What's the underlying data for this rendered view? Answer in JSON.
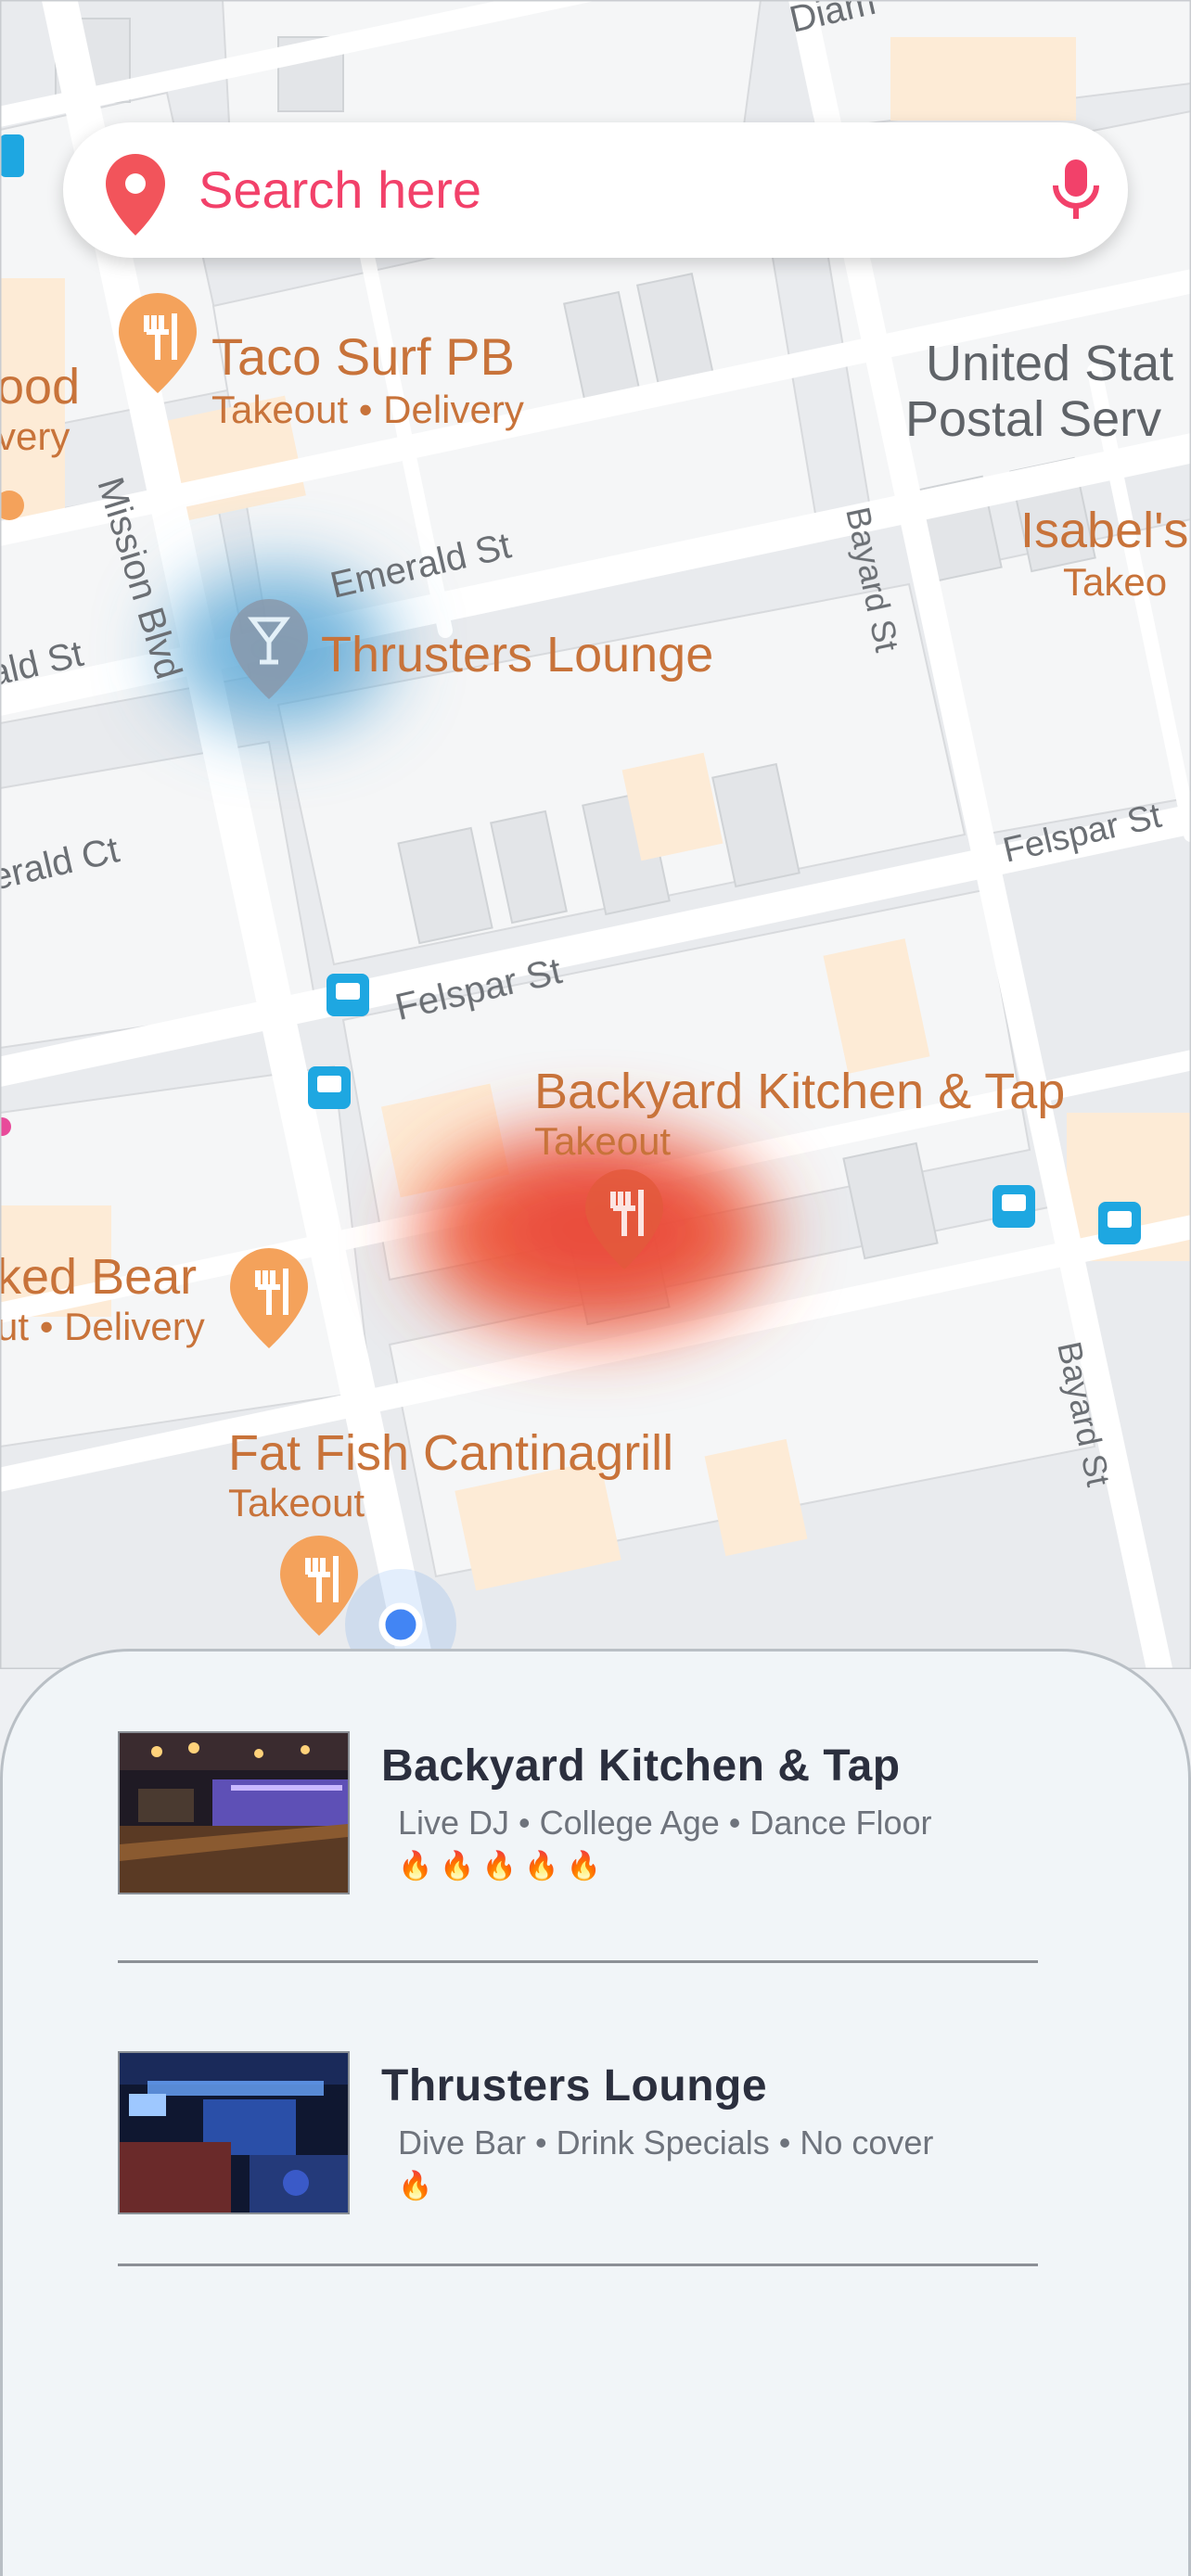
{
  "search": {
    "placeholder": "Search here"
  },
  "map": {
    "streets": [
      "Mission Blvd",
      "Emerald St",
      "Felspar St",
      "Bayard St",
      "Bayard St",
      "Felspar St",
      "ald St",
      "erald Ct",
      "Diam"
    ],
    "pois": [
      {
        "name": "Taco Surf PB",
        "sub": "Takeout • Delivery"
      },
      {
        "name": "Thrusters Lounge",
        "sub": ""
      },
      {
        "name": "Backyard Kitchen & Tap",
        "sub": "Takeout"
      },
      {
        "name": "Fat Fish Cantinagrill",
        "sub": "Takeout"
      },
      {
        "name": "ked Bear",
        "sub": "ut • Delivery"
      },
      {
        "name": "Isabel's",
        "sub": "Takeo"
      },
      {
        "name": "United Stat",
        "sub": "Postal Serv"
      },
      {
        "name": "ood",
        "sub": "very"
      }
    ],
    "colors": {
      "poi_text": "#c8733a",
      "poi_pin": "#f4a25b",
      "road_label": "#5f6368"
    }
  },
  "venues": [
    {
      "name": "Backyard Kitchen & Tap",
      "tags": "Live DJ • College Age • Dance Floor",
      "heat_level": 5,
      "heat_icon": "fire-icon"
    },
    {
      "name": "Thrusters Lounge",
      "tags": "Dive Bar • Drink Specials • No cover",
      "heat_level": 1,
      "heat_icon": "fire-icon"
    }
  ],
  "colors": {
    "accent": "#f2416a",
    "heat_hot": "#ee5a3a",
    "heat_cool": "#5aa7d6",
    "location_dot": "#1a73e8"
  }
}
